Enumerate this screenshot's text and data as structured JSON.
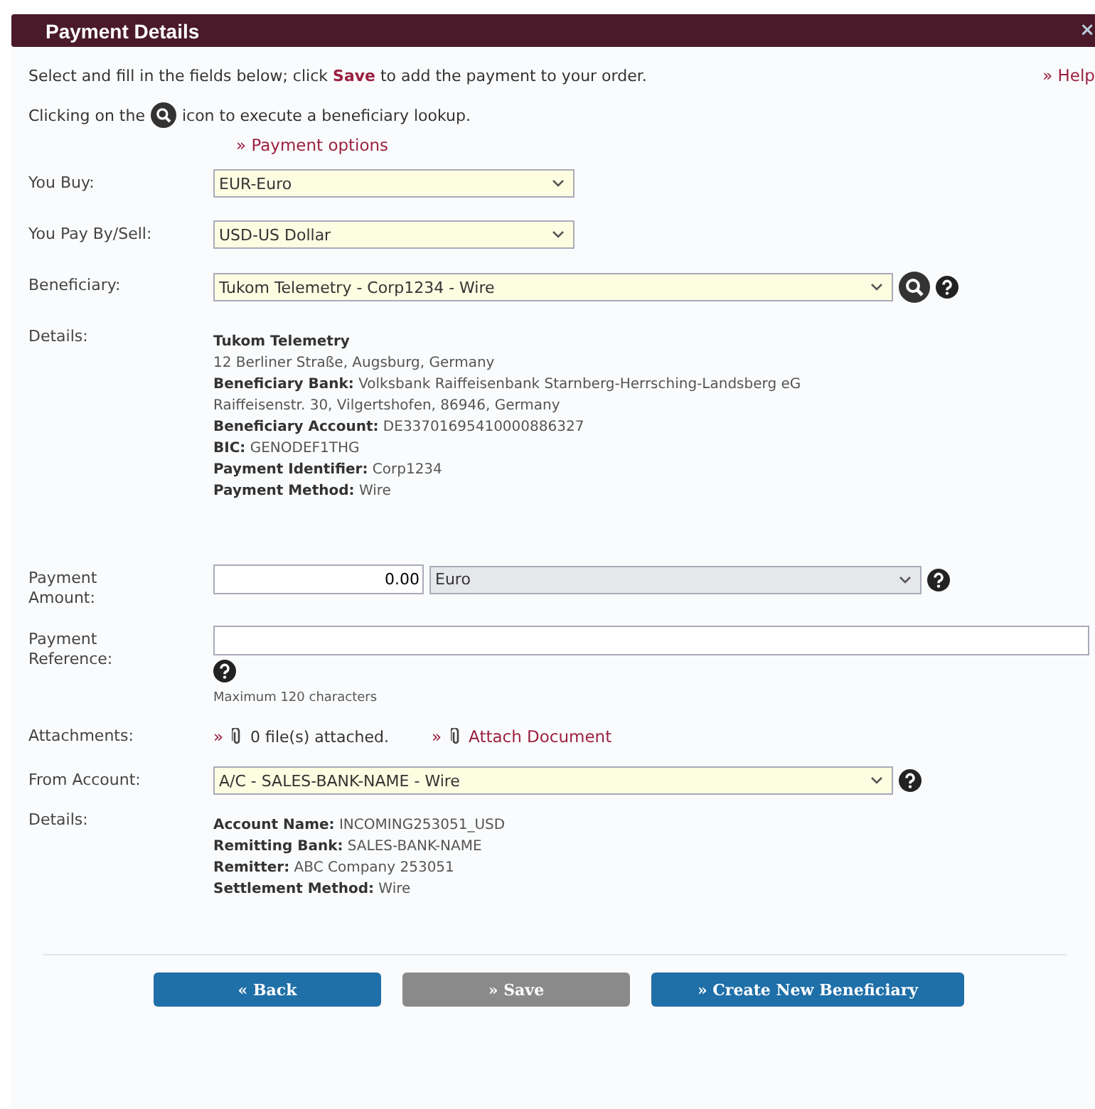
{
  "window": {
    "title": "Payment Details",
    "close": "×"
  },
  "intro": {
    "text": "Select and fill in the fields below; click **Save** to add the payment to your order.",
    "help": "» Help",
    "lookup_before": "Clicking on the",
    "lookup_after": "icon to execute a beneficiary lookup.",
    "options_link": "» Payment options"
  },
  "you_buy": {
    "label": "You Buy:",
    "value": "EUR-Euro"
  },
  "you_pay": {
    "label": "You Pay By/Sell:",
    "value": "USD-US Dollar"
  },
  "beneficiary": {
    "label": "Beneficiary:",
    "value": "Tukom Telemetry - Corp1234 - Wire"
  },
  "beneficiary_details": {
    "label": "Details:",
    "lines": [
      {
        "label": "Tukom Telemetry"
      },
      {
        "value": "12 Berliner Straße, Augsburg, Germany"
      },
      {
        "label": "Beneficiary Bank:",
        "value": "Volksbank Raiffeisenbank Starnberg-Herrsching-Landsberg eG"
      },
      {
        "value": "Raiffeisenstr. 30, Vilgertshofen, 86946, Germany"
      },
      {
        "label": "Beneficiary Account:",
        "value": "DE33701695410000886327"
      },
      {
        "label": "BIC:",
        "value": "GENODEF1THG"
      },
      {
        "label": "Payment Identifier:",
        "value": "Corp1234"
      },
      {
        "label": "Payment Method:",
        "value": "Wire"
      }
    ]
  },
  "payment_amount": {
    "label": "Payment Amount:",
    "value": "0.00",
    "currency": "Euro",
    "currency_disabled": true
  },
  "payment_reference": {
    "label": "Payment Reference:",
    "hint": "Maximum 120 characters"
  },
  "attachments": {
    "label": "Attachments:",
    "marker": "»",
    "count": "0 file(s) attached.",
    "attach_link": "Attach Document"
  },
  "from_account": {
    "label": "From Account:",
    "value": "A/C - SALES-BANK-NAME - Wire"
  },
  "account_details": {
    "label": "Details:",
    "lines": [
      {
        "label": "Account Name:",
        "value": "INCOMING253051_USD"
      },
      {
        "label": "Remitting Bank:",
        "value": "SALES-BANK-NAME"
      },
      {
        "label": "Remitter:",
        "value": "ABC Company 253051"
      },
      {
        "label": "Settlement Method:",
        "value": "Wire"
      }
    ]
  },
  "buttons": [
    {
      "label": "« Back",
      "disabled": false
    },
    {
      "label": "» Save",
      "disabled": true
    },
    {
      "label": "» Create New Beneficiary",
      "disabled": false
    }
  ]
}
